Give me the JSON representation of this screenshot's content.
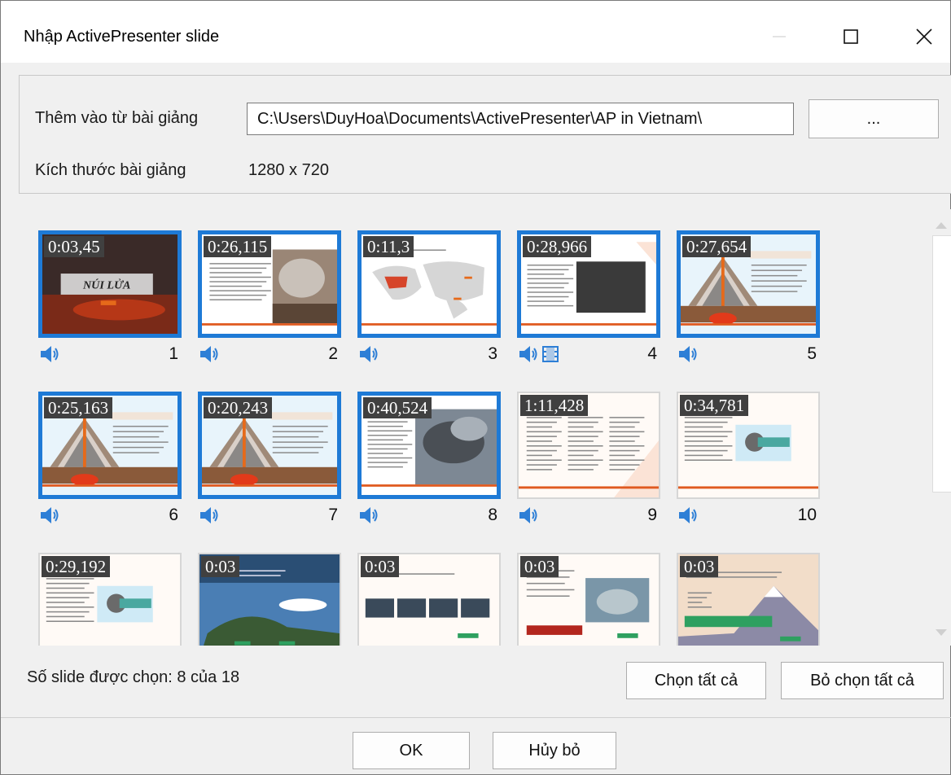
{
  "window": {
    "title": "Nhập ActivePresenter slide"
  },
  "source": {
    "label": "Thêm vào từ bài giảng",
    "path": "C:\\Users\\DuyHoa\\Documents\\ActivePresenter\\AP in Vietnam\\",
    "browse_label": "...",
    "size_label": "Kích thước bài giảng",
    "size_value": "1280 x 720"
  },
  "slides": [
    {
      "num": "1",
      "time": "0:03,45",
      "selected": true,
      "icons": [
        "audio-icon"
      ],
      "caption": "NÚI LỬA"
    },
    {
      "num": "2",
      "time": "0:26,115",
      "selected": true,
      "icons": [
        "audio-icon"
      ]
    },
    {
      "num": "3",
      "time": "0:11,3",
      "selected": true,
      "icons": [
        "audio-icon"
      ]
    },
    {
      "num": "4",
      "time": "0:28,966",
      "selected": true,
      "icons": [
        "audio-icon",
        "video-icon"
      ]
    },
    {
      "num": "5",
      "time": "0:27,654",
      "selected": true,
      "icons": [
        "audio-icon"
      ]
    },
    {
      "num": "6",
      "time": "0:25,163",
      "selected": true,
      "icons": [
        "audio-icon"
      ]
    },
    {
      "num": "7",
      "time": "0:20,243",
      "selected": true,
      "icons": [
        "audio-icon"
      ]
    },
    {
      "num": "8",
      "time": "0:40,524",
      "selected": true,
      "icons": [
        "audio-icon"
      ]
    },
    {
      "num": "9",
      "time": "1:11,428",
      "selected": false,
      "icons": [
        "audio-icon"
      ]
    },
    {
      "num": "10",
      "time": "0:34,781",
      "selected": false,
      "icons": [
        "audio-icon"
      ]
    },
    {
      "num": "",
      "time": "0:29,192",
      "selected": false,
      "icons": []
    },
    {
      "num": "",
      "time": "0:03",
      "selected": false,
      "icons": []
    },
    {
      "num": "",
      "time": "0:03",
      "selected": false,
      "icons": []
    },
    {
      "num": "",
      "time": "0:03",
      "selected": false,
      "icons": []
    },
    {
      "num": "",
      "time": "0:03",
      "selected": false,
      "icons": []
    }
  ],
  "footer": {
    "status": "Số slide được chọn: 8 của 18",
    "select_all": "Chọn tất cả",
    "deselect_all": "Bỏ chọn tất cả",
    "ok": "OK",
    "cancel": "Hủy bỏ"
  },
  "colors": {
    "selection": "#1e7ad6",
    "audio_icon": "#2e7fd6"
  }
}
